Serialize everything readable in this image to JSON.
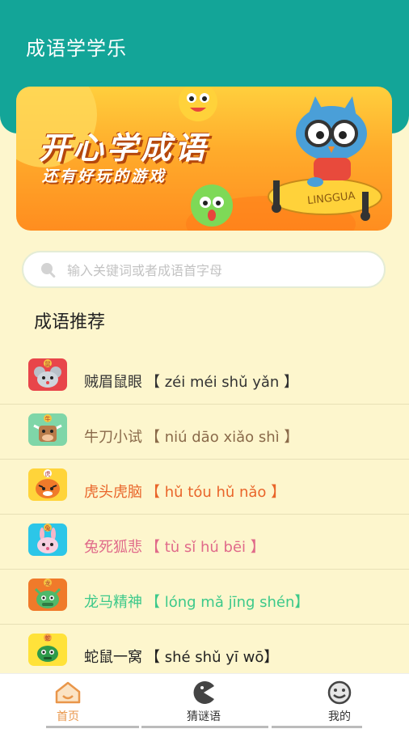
{
  "app": {
    "title": "成语学学乐"
  },
  "banner": {
    "title": "开心学成语",
    "subtitle": "还有好玩的游戏",
    "board_text": "LINGGUA"
  },
  "search": {
    "placeholder": "输入关键词或者成语首字母",
    "value": ""
  },
  "section": {
    "title": "成语推荐"
  },
  "idioms": [
    {
      "word": "贼眉鼠眼",
      "pinyin": "【 zéi méi shǔ yǎn 】",
      "color": "#333333",
      "icon": "rat-icon",
      "badge": "鼠"
    },
    {
      "word": "牛刀小试",
      "pinyin": "【 niú dāo xiǎo shì 】",
      "color": "#8a6a4a",
      "icon": "ox-icon",
      "badge": "牛"
    },
    {
      "word": "虎头虎脑",
      "pinyin": "【 hǔ tóu hǔ nǎo 】",
      "color": "#e9652a",
      "icon": "tiger-icon",
      "badge": "虎"
    },
    {
      "word": "兔死狐悲",
      "pinyin": "【  tù sǐ hú bēi  】",
      "color": "#e06a8a",
      "icon": "rabbit-icon",
      "badge": "兔"
    },
    {
      "word": "龙马精神",
      "pinyin": "【  lóng mǎ jīng shén】",
      "color": "#3cc98a",
      "icon": "dragon-icon",
      "badge": "龙"
    },
    {
      "word": "蛇鼠一窝",
      "pinyin": "【  shé shǔ yī wō】",
      "color": "#222222",
      "icon": "snake-icon",
      "badge": "蛇"
    }
  ],
  "tabs": [
    {
      "label": "首页",
      "icon": "home-icon",
      "active": true
    },
    {
      "label": "猜谜语",
      "icon": "pacman-icon",
      "active": false
    },
    {
      "label": "我的",
      "icon": "smiley-face-icon",
      "active": false
    }
  ],
  "colors": {
    "header": "#13a598",
    "background": "#fdf6cd",
    "active_tab": "#e9964a"
  }
}
